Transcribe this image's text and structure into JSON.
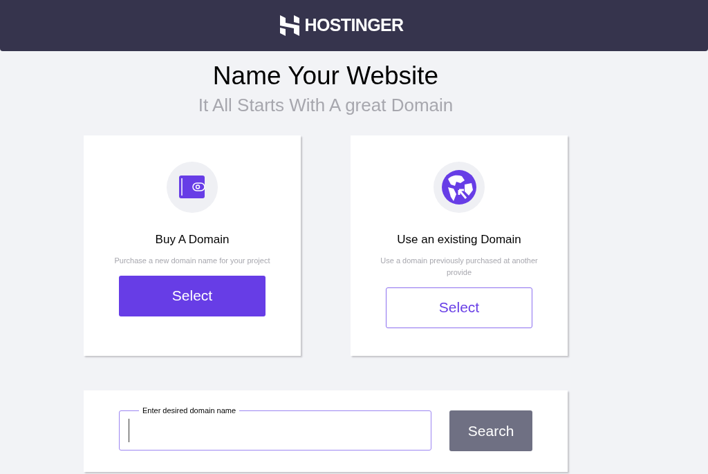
{
  "header": {
    "brand": "HOSTINGER"
  },
  "title": "Name Your Website",
  "subtitle": "It All Starts With A great Domain",
  "options": [
    {
      "kind": "wallet",
      "title": "Buy A Domain",
      "description": "Purchase a new domain name for your project",
      "button": {
        "label": "Select",
        "selected": true
      }
    },
    {
      "kind": "globe",
      "title": "Use an existing Domain",
      "description": "Use a domain previously purchased at another provide",
      "button": {
        "label": "Select",
        "selected": false
      }
    }
  ],
  "search": {
    "label": "Enter desired domain name",
    "focused": true,
    "button": {
      "label": "Search",
      "disabled": true
    }
  }
}
